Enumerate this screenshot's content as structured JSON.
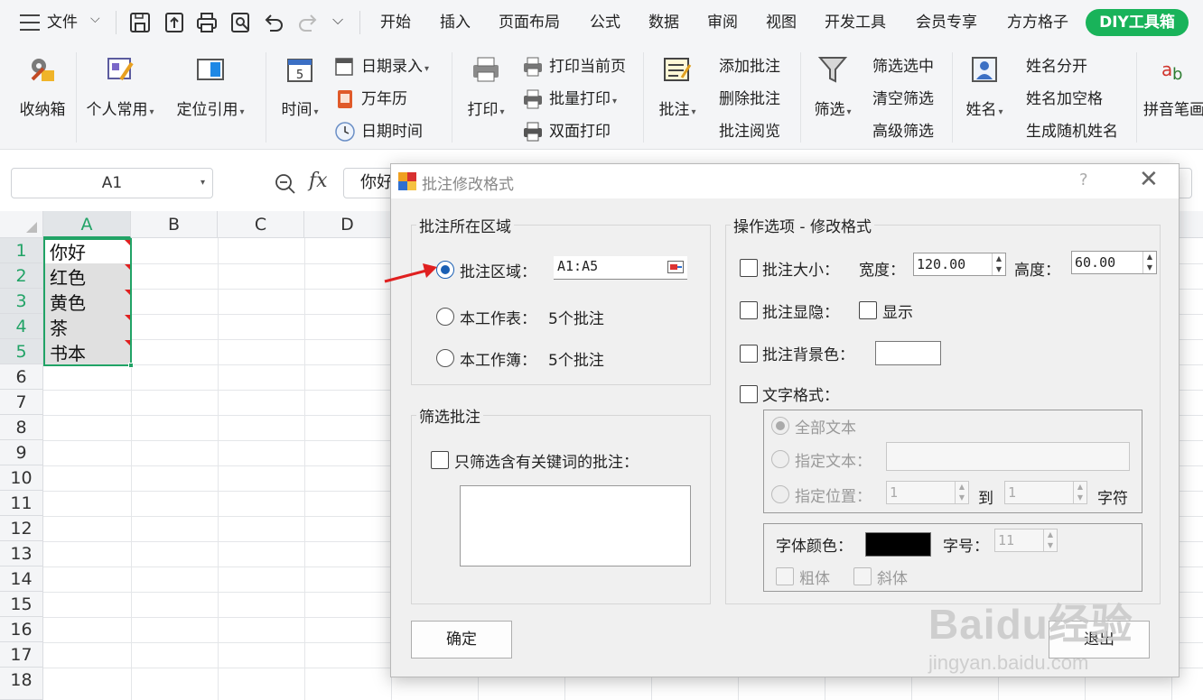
{
  "menubar": {
    "file": "文件",
    "tabs": [
      "开始",
      "插入",
      "页面布局",
      "公式",
      "数据",
      "审阅",
      "视图",
      "开发工具",
      "会员专享",
      "方方格子"
    ],
    "diy": "DIY工具箱"
  },
  "ribbon": {
    "storage": "收纳箱",
    "personal": "个人常用",
    "locate": "定位引用",
    "time": "时间",
    "date_entry": "日期录入",
    "calendar": "万年历",
    "datetime": "日期时间",
    "print": "打印",
    "print_current": "打印当前页",
    "batch_print": "批量打印",
    "duplex_print": "双面打印",
    "comment": "批注",
    "add_comment": "添加批注",
    "delete_comment": "删除批注",
    "view_comment": "批注阅览",
    "filter": "筛选",
    "filter_selected": "筛选选中",
    "clear_filter": "清空筛选",
    "advanced_filter": "高级筛选",
    "name": "姓名",
    "split_name": "姓名分开",
    "name_space": "姓名加空格",
    "random_name": "生成随机姓名",
    "pinyin": "拼音笔画"
  },
  "formula": {
    "namebox": "A1",
    "content": "你好"
  },
  "sheet": {
    "columns": [
      "A",
      "B",
      "C",
      "D"
    ],
    "rows": [
      "1",
      "2",
      "3",
      "4",
      "5",
      "6",
      "7",
      "8",
      "9",
      "10",
      "11",
      "12",
      "13",
      "14",
      "15",
      "16",
      "17",
      "18"
    ],
    "cells": [
      "你好",
      "红色",
      "黄色",
      "茶",
      "书本"
    ]
  },
  "dialog": {
    "title": "批注修改格式",
    "help": "?",
    "close": "✕",
    "region_group": "批注所在区域",
    "opt_range": "批注区域：",
    "range_value": "A1:A5",
    "opt_sheet": "本工作表：",
    "sheet_count": "5个批注",
    "opt_book": "本工作簿：",
    "book_count": "5个批注",
    "filter_group": "筛选批注",
    "filter_keyword": "只筛选含有关键词的批注：",
    "ops_group": "操作选项 - 修改格式",
    "size": "批注大小：",
    "width_label": "宽度：",
    "width_value": "120.00",
    "height_label": "高度：",
    "height_value": "60.00",
    "visibility": "批注显隐：",
    "show": "显示",
    "bg_color": "批注背景色：",
    "text_format": "文字格式：",
    "all_text": "全部文本",
    "specific_text": "指定文本：",
    "specific_pos": "指定位置：",
    "pos_from": "1",
    "to": "到",
    "pos_to": "1",
    "chars": "字符",
    "font_color": "字体颜色：",
    "font_size_label": "字号：",
    "font_size": "11",
    "bold": "粗体",
    "italic": "斜体",
    "ok": "确定",
    "exit": "退出"
  },
  "watermark": {
    "logo": "Baidu经验",
    "url": "jingyan.baidu.com"
  },
  "colors": {
    "accent_green": "#19b35a",
    "selection_green": "#21a366",
    "radio_blue": "#1a5fb4",
    "comment_marker": "#e02020"
  }
}
